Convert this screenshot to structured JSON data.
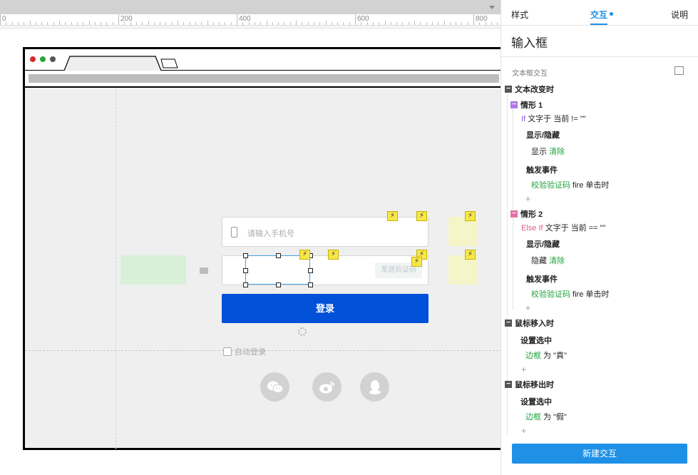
{
  "ruler": {
    "labels": [
      "0",
      "200",
      "400",
      "600",
      "800"
    ]
  },
  "panel": {
    "tabs": {
      "style": "样式",
      "interaction": "交互",
      "notes": "说明"
    },
    "widget_title": "输入框",
    "section_label": "文本框交互",
    "events": [
      {
        "name": "文本改变时",
        "cases": [
          {
            "name": "情形 1",
            "condition": {
              "keyword": "If",
              "text": "文字于 当前 != \"\""
            },
            "actions": [
              {
                "title": "显示/隐藏",
                "detail": {
                  "prefix": "显示",
                  "target": "清除",
                  "suffix": ""
                }
              },
              {
                "title": "触发事件",
                "detail": {
                  "prefix": "",
                  "target": "校验验证码",
                  "suffix": " fire 单击时"
                }
              }
            ],
            "add": "+"
          },
          {
            "name": "情形 2",
            "condition": {
              "keyword": "Else If",
              "text": "文字于 当前 == \"\""
            },
            "actions": [
              {
                "title": "显示/隐藏",
                "detail": {
                  "prefix": "隐藏",
                  "target": "清除",
                  "suffix": ""
                }
              },
              {
                "title": "触发事件",
                "detail": {
                  "prefix": "",
                  "target": "校验验证码",
                  "suffix": " fire 单击时"
                }
              }
            ],
            "add": "+"
          }
        ]
      },
      {
        "name": "鼠标移入时",
        "actions": [
          {
            "title": "设置选中",
            "detail": {
              "target": "边框",
              "suffix": " 为 \"真\""
            }
          }
        ],
        "add": "+"
      },
      {
        "name": "鼠标移出时",
        "actions": [
          {
            "title": "设置选中",
            "detail": {
              "target": "边框",
              "suffix": " 为 \"假\""
            }
          }
        ],
        "add": "+"
      }
    ],
    "new_interaction": "新建交互"
  },
  "design": {
    "phone_placeholder": "请输入手机号",
    "send_code": "发送验证码",
    "login": "登录",
    "auto_login": "自动登录",
    "bolt": "⚡"
  },
  "colors": {
    "accent": "#1e90e6",
    "login_button": "#0050d8",
    "green_text": "#22a33e",
    "note_yellow": "#f5f5c9",
    "note_green": "#d8f0d8"
  },
  "icons": {
    "social": [
      "wechat-icon",
      "weibo-icon",
      "qq-icon"
    ]
  }
}
